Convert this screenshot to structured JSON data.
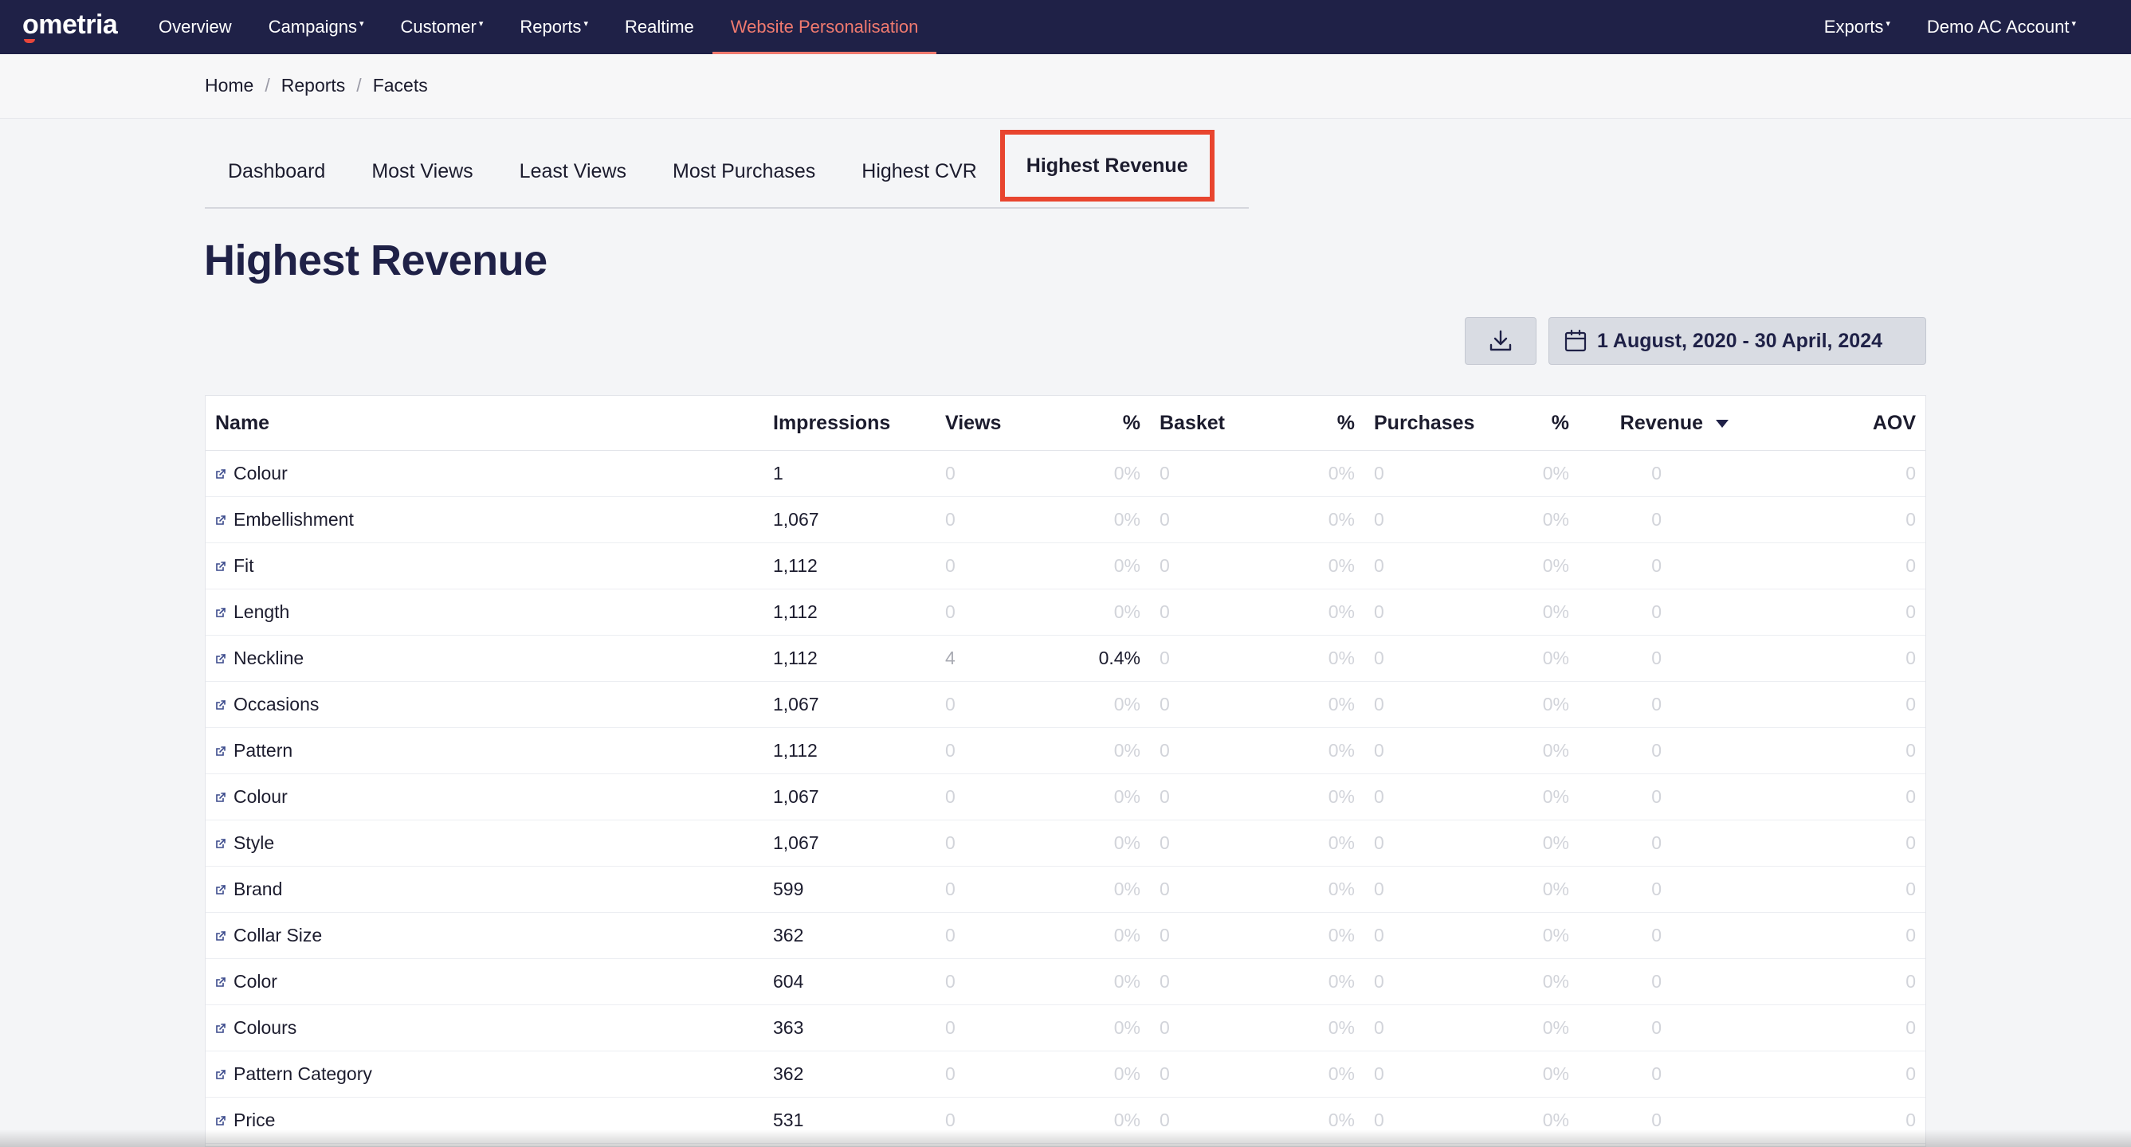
{
  "app": {
    "logo": "ometria"
  },
  "nav": {
    "left": [
      {
        "label": "Overview",
        "caret": false,
        "active": false
      },
      {
        "label": "Campaigns",
        "caret": true,
        "active": false
      },
      {
        "label": "Customer",
        "caret": true,
        "active": false
      },
      {
        "label": "Reports",
        "caret": true,
        "active": false
      },
      {
        "label": "Realtime",
        "caret": false,
        "active": false
      },
      {
        "label": "Website Personalisation",
        "caret": false,
        "active": true
      }
    ],
    "right": [
      {
        "label": "Exports",
        "caret": true
      },
      {
        "label": "Demo AC Account",
        "caret": true
      }
    ],
    "caret_glyph": "▾"
  },
  "breadcrumb": {
    "items": [
      "Home",
      "Reports",
      "Facets"
    ],
    "separator": "/"
  },
  "tabs": [
    {
      "label": "Dashboard",
      "active": false
    },
    {
      "label": "Most Views",
      "active": false
    },
    {
      "label": "Least Views",
      "active": false
    },
    {
      "label": "Most Purchases",
      "active": false
    },
    {
      "label": "Highest CVR",
      "active": false
    },
    {
      "label": "Highest Revenue",
      "active": true
    }
  ],
  "page": {
    "title": "Highest Revenue"
  },
  "toolbar": {
    "download_icon": "download-icon",
    "date_range": "1 August, 2020 - 30 April, 2024",
    "calendar_icon": "calendar-icon"
  },
  "table": {
    "columns": [
      "Name",
      "Impressions",
      "Views",
      "%",
      "Basket",
      "%",
      "Purchases",
      "%",
      "Revenue",
      "AOV"
    ],
    "sorted_column": "Revenue",
    "rows": [
      {
        "name": "Colour",
        "impressions": "1",
        "views": "0",
        "views_pct": "0%",
        "basket": "0",
        "basket_pct": "0%",
        "purchases": "0",
        "purchases_pct": "0%",
        "revenue": "0",
        "aov": "0"
      },
      {
        "name": "Embellishment",
        "impressions": "1,067",
        "views": "0",
        "views_pct": "0%",
        "basket": "0",
        "basket_pct": "0%",
        "purchases": "0",
        "purchases_pct": "0%",
        "revenue": "0",
        "aov": "0"
      },
      {
        "name": "Fit",
        "impressions": "1,112",
        "views": "0",
        "views_pct": "0%",
        "basket": "0",
        "basket_pct": "0%",
        "purchases": "0",
        "purchases_pct": "0%",
        "revenue": "0",
        "aov": "0"
      },
      {
        "name": "Length",
        "impressions": "1,112",
        "views": "0",
        "views_pct": "0%",
        "basket": "0",
        "basket_pct": "0%",
        "purchases": "0",
        "purchases_pct": "0%",
        "revenue": "0",
        "aov": "0"
      },
      {
        "name": "Neckline",
        "impressions": "1,112",
        "views": "4",
        "views_pct": "0.4%",
        "basket": "0",
        "basket_pct": "0%",
        "purchases": "0",
        "purchases_pct": "0%",
        "revenue": "0",
        "aov": "0"
      },
      {
        "name": "Occasions",
        "impressions": "1,067",
        "views": "0",
        "views_pct": "0%",
        "basket": "0",
        "basket_pct": "0%",
        "purchases": "0",
        "purchases_pct": "0%",
        "revenue": "0",
        "aov": "0"
      },
      {
        "name": "Pattern",
        "impressions": "1,112",
        "views": "0",
        "views_pct": "0%",
        "basket": "0",
        "basket_pct": "0%",
        "purchases": "0",
        "purchases_pct": "0%",
        "revenue": "0",
        "aov": "0"
      },
      {
        "name": "Colour",
        "impressions": "1,067",
        "views": "0",
        "views_pct": "0%",
        "basket": "0",
        "basket_pct": "0%",
        "purchases": "0",
        "purchases_pct": "0%",
        "revenue": "0",
        "aov": "0"
      },
      {
        "name": "Style",
        "impressions": "1,067",
        "views": "0",
        "views_pct": "0%",
        "basket": "0",
        "basket_pct": "0%",
        "purchases": "0",
        "purchases_pct": "0%",
        "revenue": "0",
        "aov": "0"
      },
      {
        "name": "Brand",
        "impressions": "599",
        "views": "0",
        "views_pct": "0%",
        "basket": "0",
        "basket_pct": "0%",
        "purchases": "0",
        "purchases_pct": "0%",
        "revenue": "0",
        "aov": "0"
      },
      {
        "name": "Collar Size",
        "impressions": "362",
        "views": "0",
        "views_pct": "0%",
        "basket": "0",
        "basket_pct": "0%",
        "purchases": "0",
        "purchases_pct": "0%",
        "revenue": "0",
        "aov": "0"
      },
      {
        "name": "Color",
        "impressions": "604",
        "views": "0",
        "views_pct": "0%",
        "basket": "0",
        "basket_pct": "0%",
        "purchases": "0",
        "purchases_pct": "0%",
        "revenue": "0",
        "aov": "0"
      },
      {
        "name": "Colours",
        "impressions": "363",
        "views": "0",
        "views_pct": "0%",
        "basket": "0",
        "basket_pct": "0%",
        "purchases": "0",
        "purchases_pct": "0%",
        "revenue": "0",
        "aov": "0"
      },
      {
        "name": "Pattern Category",
        "impressions": "362",
        "views": "0",
        "views_pct": "0%",
        "basket": "0",
        "basket_pct": "0%",
        "purchases": "0",
        "purchases_pct": "0%",
        "revenue": "0",
        "aov": "0"
      },
      {
        "name": "Price",
        "impressions": "531",
        "views": "0",
        "views_pct": "0%",
        "basket": "0",
        "basket_pct": "0%",
        "purchases": "0",
        "purchases_pct": "0%",
        "revenue": "0",
        "aov": "0"
      }
    ]
  },
  "colors": {
    "nav_bg": "#1f2147",
    "accent": "#f07a6f",
    "highlight_box": "#e8452f"
  }
}
